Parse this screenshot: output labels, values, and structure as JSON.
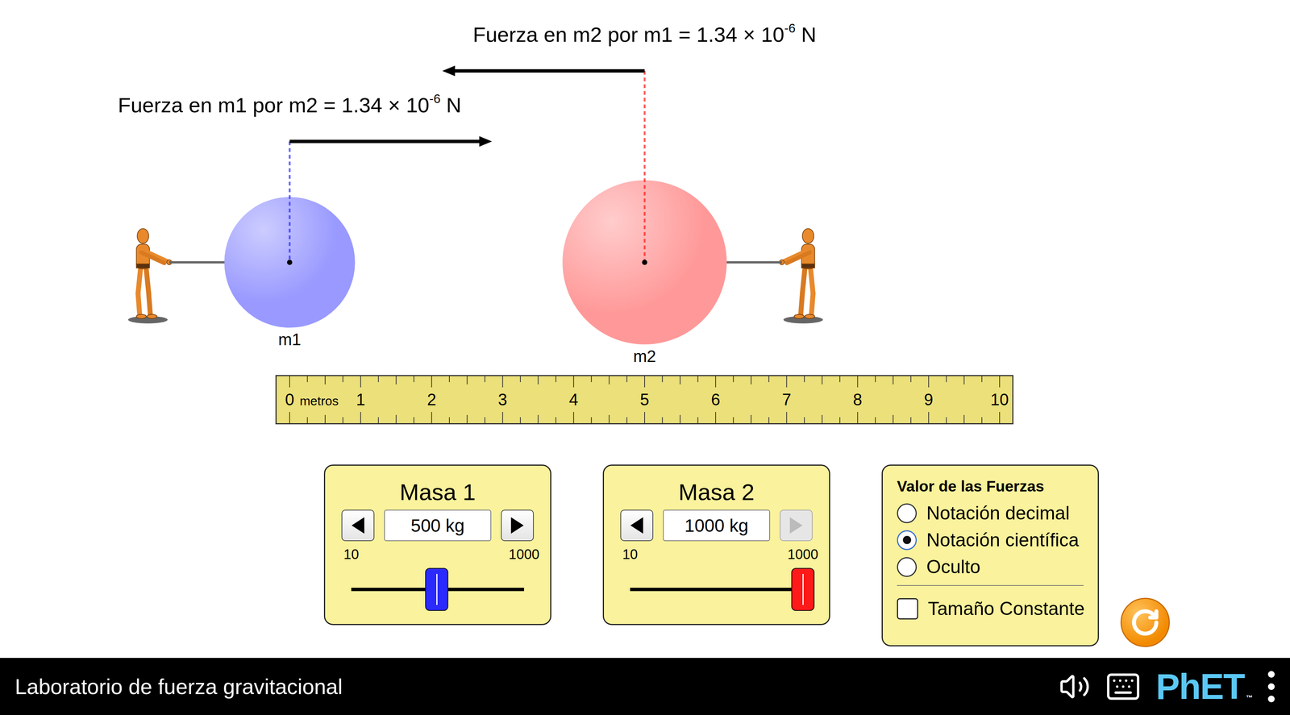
{
  "forces": [
    {
      "of": "m1",
      "label": "Fuerza en m1 por m2 = 1.34 × 10",
      "exponent": "-6",
      "unit": "N",
      "direction": "right"
    },
    {
      "of": "m2",
      "label": "Fuerza en m2 por m1 = 1.34 × 10",
      "exponent": "-6",
      "unit": "N",
      "direction": "left"
    }
  ],
  "masses": [
    {
      "name": "m1",
      "panel_title": "Masa 1",
      "value": "500 kg",
      "min": "10",
      "max": "1000",
      "level": 0.495,
      "position_m": 0,
      "color": "#9999ff",
      "thumb_color": "#2a2aff",
      "decrement_disabled": false,
      "increment_disabled": false
    },
    {
      "name": "m2",
      "panel_title": "Masa 2",
      "value": "1000 kg",
      "min": "10",
      "max": "1000",
      "level": 1,
      "position_m": 5,
      "color": "#ff9999",
      "thumb_color": "#ff1a1a",
      "decrement_disabled": false,
      "increment_disabled": true
    }
  ],
  "ruler": {
    "unit": "metros",
    "labels": [
      "0",
      "1",
      "2",
      "3",
      "4",
      "5",
      "6",
      "7",
      "8",
      "9",
      "10"
    ]
  },
  "force_display": {
    "title": "Valor de las Fuerzas",
    "options": [
      {
        "label": "Notación decimal",
        "selected": false
      },
      {
        "label": "Notación científica",
        "selected": true
      },
      {
        "label": "Oculto",
        "selected": false
      }
    ],
    "checkbox": {
      "label": "Tamaño Constante",
      "checked": false
    }
  },
  "navbar": {
    "title": "Laboratorio de fuerza gravitacional",
    "logo": "PhET",
    "trademark": "™"
  }
}
